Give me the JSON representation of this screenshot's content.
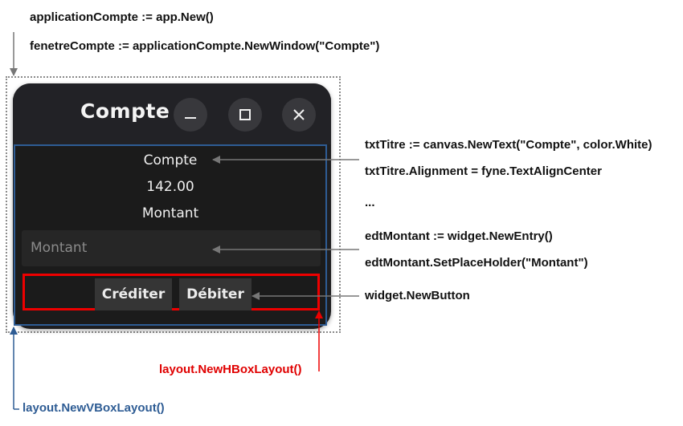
{
  "code_top": {
    "line1": "applicationCompte := app.New()",
    "line2": "fenetreCompte := applicationCompte.NewWindow(\"Compte\")"
  },
  "window": {
    "title": "Compte",
    "content": {
      "title_text": "Compte",
      "value_text": "142.00",
      "label_text": "Montant",
      "entry_placeholder": "Montant",
      "buttons": [
        "Créditer",
        "Débiter"
      ]
    }
  },
  "annotations": {
    "text_line1": "txtTitre := canvas.NewText(\"Compte\", color.White)",
    "text_line2": "txtTitre.Alignment = fyne.TextAlignCenter",
    "ellipsis": "...",
    "entry_line1": "edtMontant := widget.NewEntry()",
    "entry_line2": "edtMontant.SetPlaceHolder(\"Montant\")",
    "button": "widget.NewButton",
    "hbox": "layout.NewHBoxLayout()",
    "vbox": "layout.NewVBoxLayout()"
  },
  "colors": {
    "hbox_red": "#e00000",
    "vbox_blue": "#2e5c94",
    "window_dark": "#1e1e20"
  }
}
